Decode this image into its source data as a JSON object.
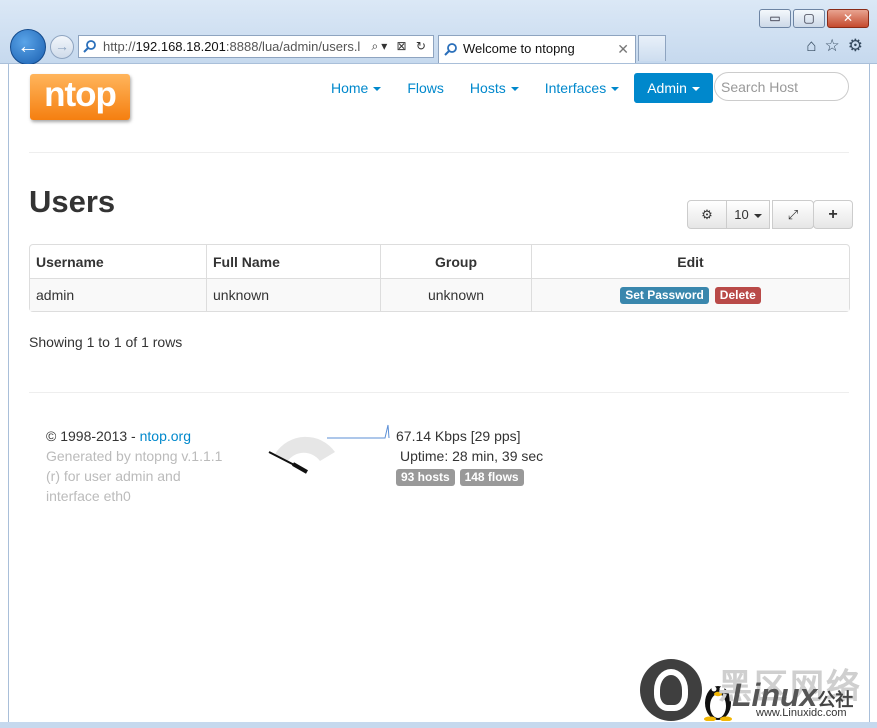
{
  "browser": {
    "window_buttons": {
      "minimize": "▭",
      "maximize": "▢",
      "close": "✕"
    },
    "back_glyph": "🡐",
    "forward_glyph": "⇨",
    "address_prefix": "http://",
    "address_host": "192.168.18.201",
    "address_rest": ":8888/lua/admin/users.l",
    "address_tools": "⌕▾ ⊠ ↻",
    "tab_title": "Welcome to ntopng",
    "tab_close": "✕",
    "toolbar_icons": {
      "home": "⌂",
      "favorites": "☆",
      "settings": "⚙"
    }
  },
  "header": {
    "logo_text": "ntop",
    "nav": [
      {
        "label": "Home",
        "dropdown": true
      },
      {
        "label": "Flows",
        "dropdown": false
      },
      {
        "label": "Hosts",
        "dropdown": true
      },
      {
        "label": "Interfaces",
        "dropdown": true
      },
      {
        "label": "Admin",
        "dropdown": true,
        "active": true
      }
    ],
    "search_placeholder": "Search Host"
  },
  "main": {
    "title": "Users",
    "toolbar": {
      "settings_glyph": "⚙",
      "page_size": "10",
      "expand_glyph": "⤢",
      "add_glyph": "+"
    },
    "table": {
      "columns": [
        "Username",
        "Full Name",
        "Group",
        "Edit"
      ],
      "rows": [
        {
          "username": "admin",
          "full_name": "unknown",
          "group": "unknown",
          "actions": [
            "Set Password",
            "Delete"
          ]
        }
      ]
    },
    "showing_text": "Showing 1 to 1 of 1 rows"
  },
  "footer": {
    "copyright": "© 1998-2013 - ",
    "link": "ntop.org",
    "generated": "Generated by ntopng v.1.1.1 (r) for user admin and interface eth0",
    "throughput": "67.14 Kbps [29 pps]",
    "uptime": "Uptime: 28 min, 39 sec",
    "hosts_badge": "93 hosts",
    "flows_badge": "148 flows"
  },
  "watermark": {
    "cjk": "黑区网络",
    "brand": "Linux",
    "site": "www.Linuxidc.com",
    "suffix": "公社"
  },
  "colors": {
    "link": "#0088cc",
    "logo_orange": "#f57f10",
    "info": "#3a87ad",
    "danger": "#b94a48",
    "badge_grey": "#999999"
  }
}
